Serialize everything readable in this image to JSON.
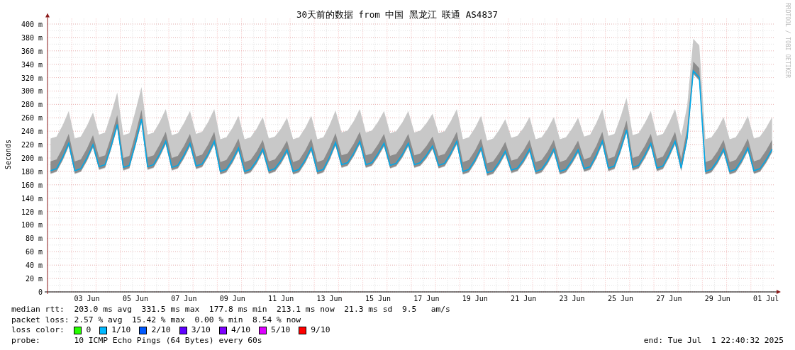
{
  "title": "30天前的数据 from 中国 黑龙江 联通 AS4837",
  "credit": "RRDTOOL / TOBI OETIKER",
  "chart_data": {
    "type": "line",
    "grid": true,
    "ylabel": "Seconds",
    "ylim": [
      0,
      408
    ],
    "categories": [
      null,
      null,
      null,
      null,
      null,
      null,
      "03 Jun",
      null,
      null,
      null,
      null,
      null,
      null,
      null,
      "05 Jun",
      null,
      null,
      null,
      null,
      null,
      null,
      null,
      "07 Jun",
      null,
      null,
      null,
      null,
      null,
      null,
      null,
      "09 Jun",
      null,
      null,
      null,
      null,
      null,
      null,
      null,
      "11 Jun",
      null,
      null,
      null,
      null,
      null,
      null,
      null,
      "13 Jun",
      null,
      null,
      null,
      null,
      null,
      null,
      null,
      "15 Jun",
      null,
      null,
      null,
      null,
      null,
      null,
      null,
      "17 Jun",
      null,
      null,
      null,
      null,
      null,
      null,
      null,
      "19 Jun",
      null,
      null,
      null,
      null,
      null,
      null,
      null,
      "21 Jun",
      null,
      null,
      null,
      null,
      null,
      null,
      null,
      "23 Jun",
      null,
      null,
      null,
      null,
      null,
      null,
      null,
      "25 Jun",
      null,
      null,
      null,
      null,
      null,
      null,
      null,
      "27 Jun",
      null,
      null,
      null,
      null,
      null,
      null,
      null,
      "29 Jun",
      null,
      null,
      null,
      null,
      null,
      null,
      null,
      "01 Jul",
      null
    ],
    "series": [
      {
        "name": "median rtt:",
        "color": "#00a8e8",
        "values": [
          181,
          184,
          201,
          222,
          181,
          184,
          200,
          220,
          187,
          190,
          218,
          250,
          186,
          189,
          222,
          258,
          187,
          190,
          206,
          225,
          186,
          189,
          204,
          222,
          188,
          191,
          206,
          225,
          180,
          183,
          197,
          215,
          180,
          183,
          196,
          213,
          181,
          184,
          196,
          212,
          180,
          183,
          197,
          215,
          180,
          183,
          201,
          223,
          190,
          193,
          207,
          225,
          190,
          193,
          206,
          222,
          189,
          192,
          205,
          222,
          190,
          193,
          204,
          218,
          189,
          192,
          207,
          225,
          180,
          183,
          197,
          215,
          178,
          181,
          194,
          210,
          182,
          185,
          197,
          213,
          180,
          183,
          196,
          213,
          180,
          183,
          196,
          212,
          184,
          187,
          204,
          225,
          185,
          188,
          213,
          242,
          186,
          189,
          204,
          222,
          185,
          188,
          205,
          225,
          185,
          230,
          330,
          320,
          180,
          183,
          196,
          213,
          180,
          183,
          197,
          215,
          181,
          184,
          197,
          213
        ]
      }
    ],
    "yticks": [
      {
        "value": 0,
        "label": "0"
      },
      {
        "value": 20,
        "label": "20 m"
      },
      {
        "value": 40,
        "label": "40 m"
      },
      {
        "value": 60,
        "label": "60 m"
      },
      {
        "value": 80,
        "label": "80 m"
      },
      {
        "value": 100,
        "label": "100 m"
      },
      {
        "value": 120,
        "label": "120 m"
      },
      {
        "value": 140,
        "label": "140 m"
      },
      {
        "value": 160,
        "label": "160 m"
      },
      {
        "value": 180,
        "label": "180 m"
      },
      {
        "value": 200,
        "label": "200 m"
      },
      {
        "value": 220,
        "label": "220 m"
      },
      {
        "value": 240,
        "label": "240 m"
      },
      {
        "value": 260,
        "label": "260 m"
      },
      {
        "value": 280,
        "label": "280 m"
      },
      {
        "value": 300,
        "label": "300 m"
      },
      {
        "value": 320,
        "label": "320 m"
      },
      {
        "value": 340,
        "label": "340 m"
      },
      {
        "value": 360,
        "label": "360 m"
      },
      {
        "value": 380,
        "label": "380 m"
      },
      {
        "value": 400,
        "label": "400 m"
      }
    ]
  },
  "stats": [
    "203.0 ms avg  331.5 ms max  177.8 ms min  213.1 ms now  21.3 ms sd  9.5   am/s",
    "packet loss: 2.57 % avg  15.42 % max  0.00 % min  8.54 % now"
  ],
  "loss_legend": {
    "label": "loss color:",
    "items": [
      {
        "label": "0",
        "color": "#26ff00"
      },
      {
        "label": "1/10",
        "color": "#00b8ff"
      },
      {
        "label": "2/10",
        "color": "#0059ff"
      },
      {
        "label": "3/10",
        "color": "#5e00ff"
      },
      {
        "label": "4/10",
        "color": "#7e00ff"
      },
      {
        "label": "5/10",
        "color": "#dd00ff"
      },
      {
        "label": "9/10",
        "color": "#ff0000"
      }
    ]
  },
  "probe": {
    "label": "probe:",
    "value": "10 ICMP Echo Pings (64 Bytes) every 60s"
  },
  "end": "end: Tue Jul  1 22:40:32 2025"
}
